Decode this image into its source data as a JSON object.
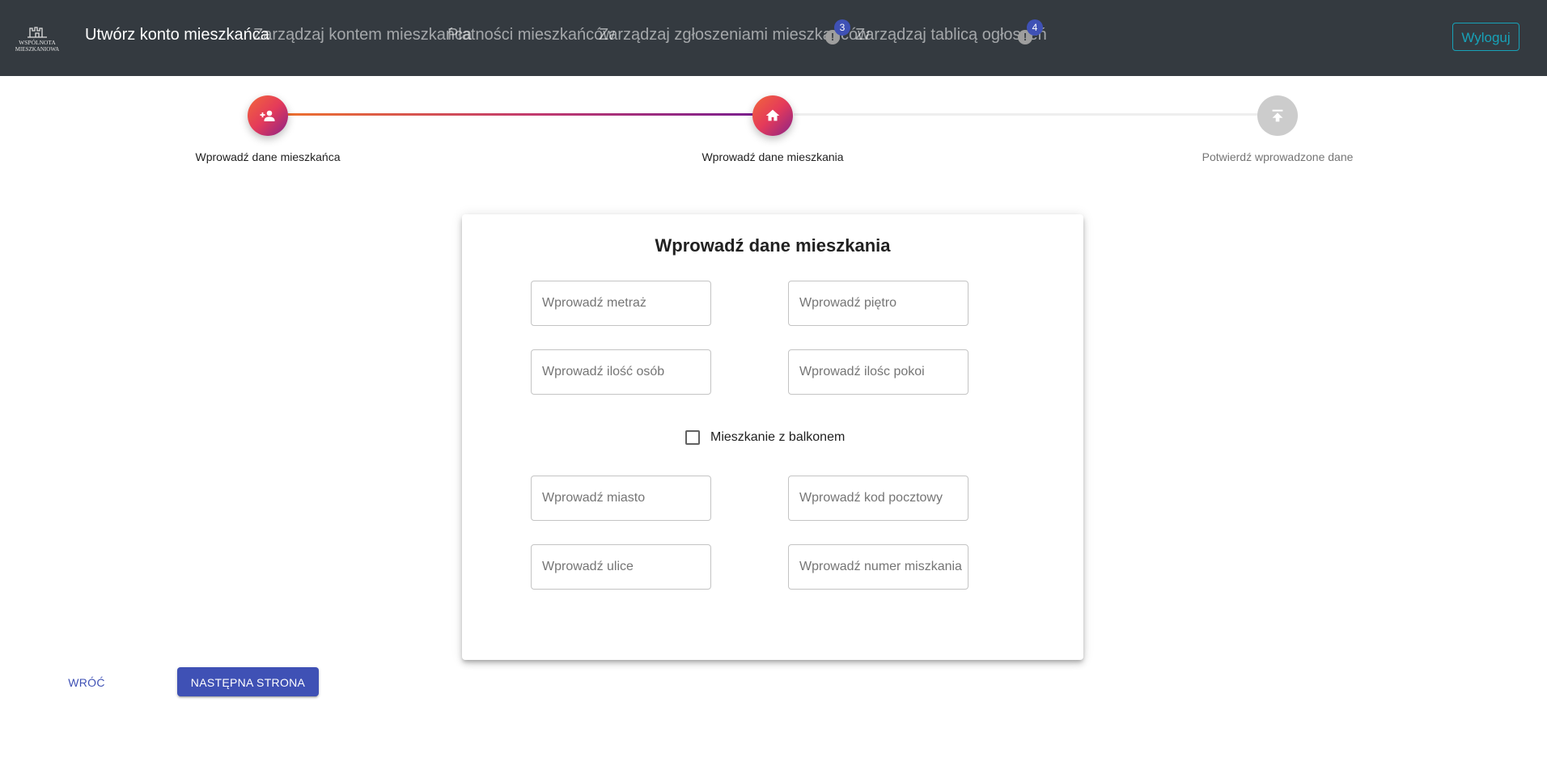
{
  "navbar": {
    "logo": {
      "icon": "castle-icon",
      "line1": "WSPÓLNOTA",
      "line2": "MIESZKANIOWA"
    },
    "links": [
      {
        "label": "Utwórz konto mieszkańca",
        "active": true
      },
      {
        "label": "Zarządzaj kontem mieszkańca",
        "active": false
      },
      {
        "label": "Płatności mieszkańców",
        "active": false
      },
      {
        "label": "Zarządzaj zgłoszeniami mieszkańców",
        "active": false,
        "badge": "3",
        "icon": "alert-icon"
      },
      {
        "label": "Zarządzaj tablicą ogłoszeń",
        "active": false,
        "badge": "4",
        "icon": "alert-icon"
      }
    ],
    "alert_glyph": "!",
    "logout_label": "Wyloguj",
    "colors": {
      "background": "#343a40",
      "badge": "#3f51b5",
      "logout": "#17a2b8"
    }
  },
  "stepper": {
    "steps": [
      {
        "label": "Wprowadź dane mieszkańca",
        "icon": "person-add-icon",
        "state": "completed"
      },
      {
        "label": "Wprowadź dane mieszkania",
        "icon": "home-icon",
        "state": "active"
      },
      {
        "label": "Potwierdź wprowadzone dane",
        "icon": "publish-icon",
        "state": "inactive"
      }
    ]
  },
  "form": {
    "title": "Wprowadź dane mieszkania",
    "fields": {
      "area": {
        "placeholder": "Wprowadź metraż",
        "value": ""
      },
      "floor": {
        "placeholder": "Wprowadź piętro",
        "value": ""
      },
      "persons": {
        "placeholder": "Wprowadź ilość osób",
        "value": ""
      },
      "rooms": {
        "placeholder": "Wprowadź ilośc pokoi",
        "value": ""
      },
      "city": {
        "placeholder": "Wprowadź miasto",
        "value": ""
      },
      "postal_code": {
        "placeholder": "Wprowadź kod pocztowy",
        "value": ""
      },
      "street": {
        "placeholder": "Wprowadź ulice",
        "value": ""
      },
      "apartment_number": {
        "placeholder": "Wprowadź numer miszkania",
        "value": ""
      }
    },
    "balcony": {
      "label": "Mieszkanie z balkonem",
      "checked": false
    }
  },
  "actions": {
    "back_label": "WRÓĆ",
    "next_label": "NASTĘPNA STRONA",
    "colors": {
      "primary": "#3f51b5"
    }
  }
}
